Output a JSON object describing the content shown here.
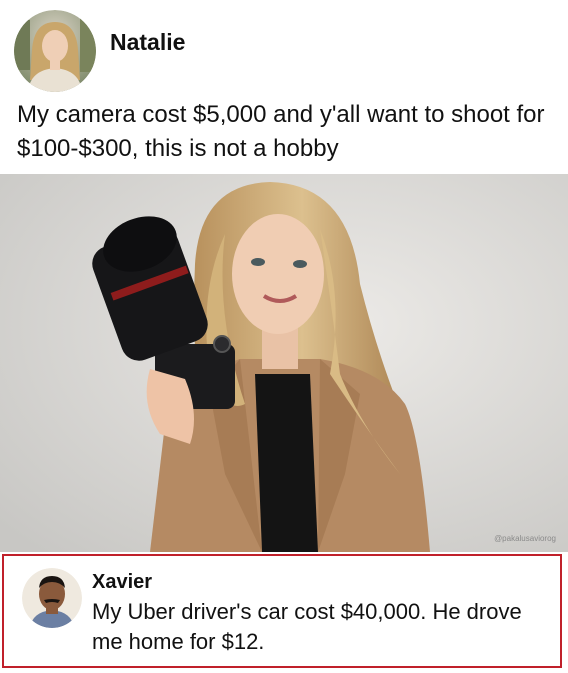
{
  "post": {
    "author": "Natalie",
    "text": "My camera cost $5,000 and y'all want to shoot for $100-$300, this is not a hobby"
  },
  "photo": {
    "watermark": "@pakalusaviorog"
  },
  "reply": {
    "author": "Xavier",
    "text": "My Uber driver's car cost $40,000. He drove me home for $12."
  },
  "colors": {
    "highlight_border": "#c0202a",
    "blazer": "#b58a63",
    "backdrop": "#d9d9d7"
  }
}
